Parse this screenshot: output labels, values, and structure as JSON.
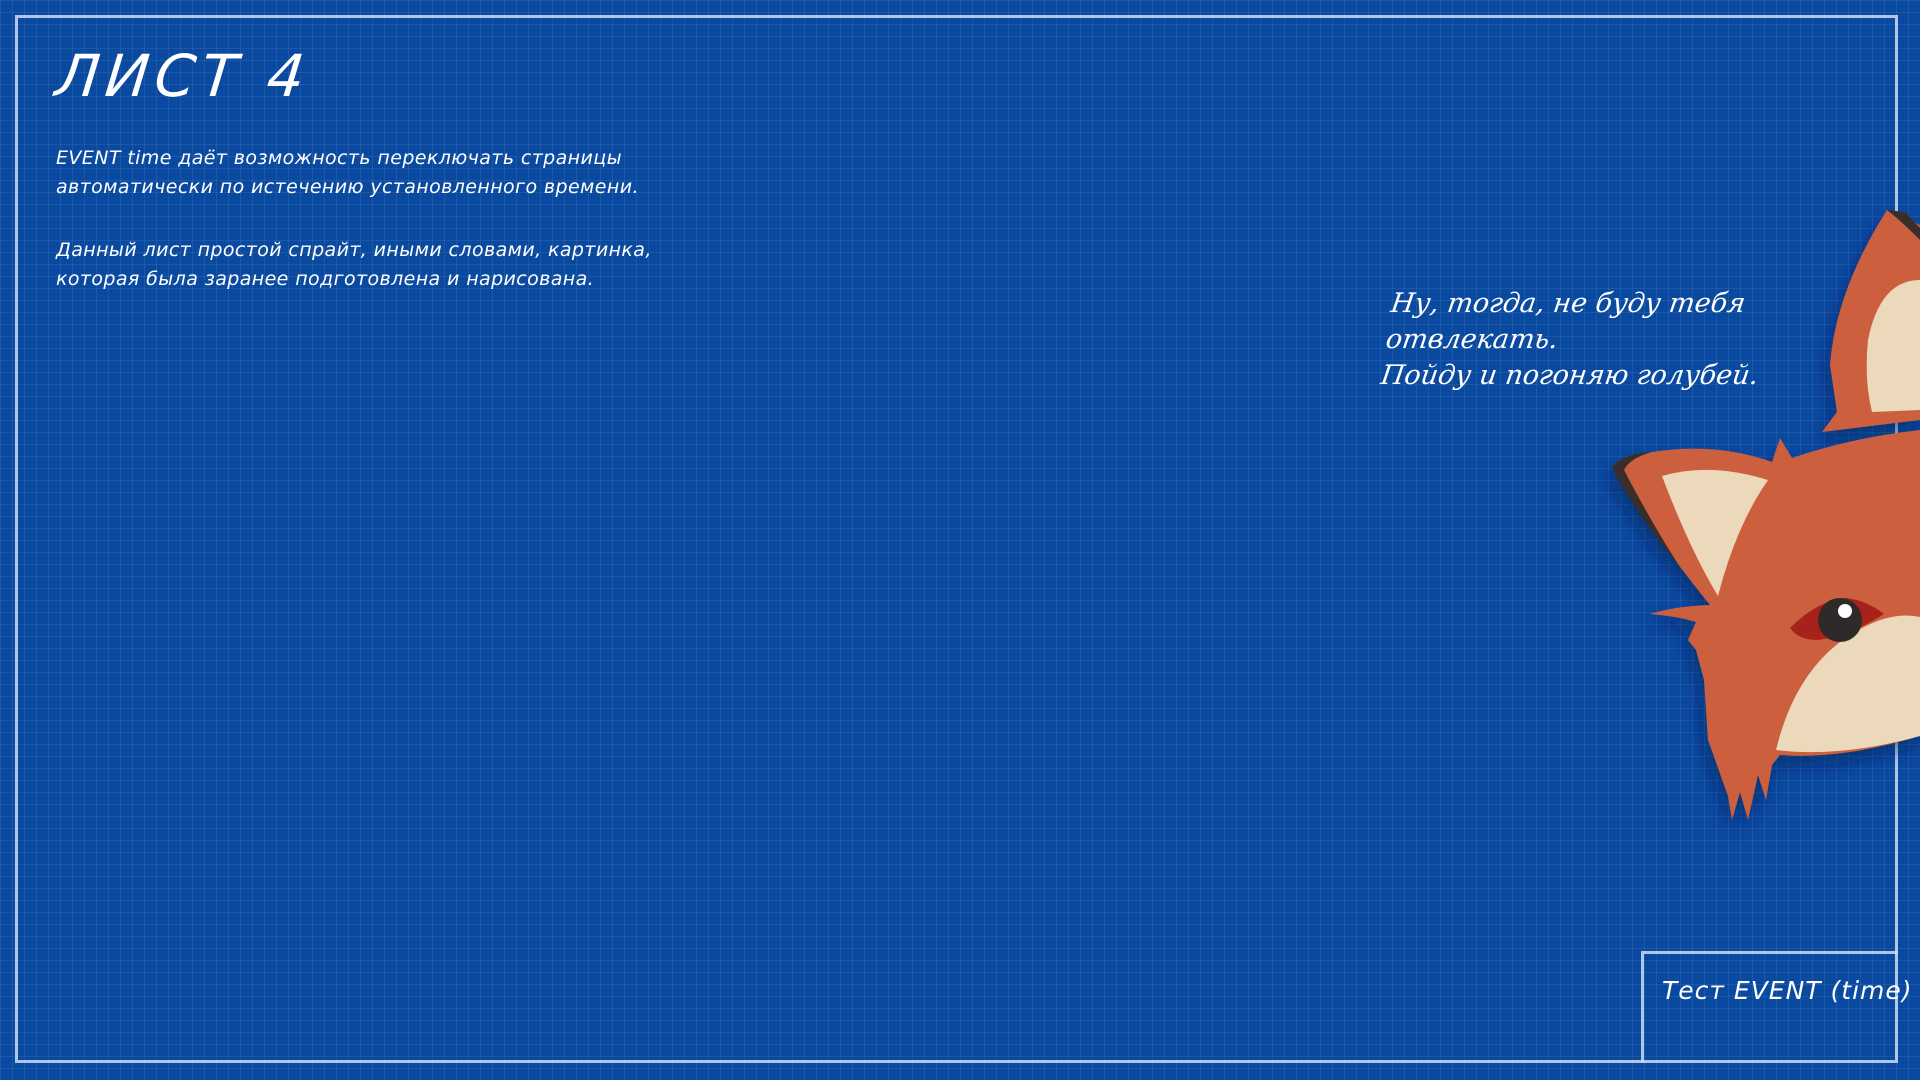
{
  "sheet": {
    "title": "ЛИСТ 4",
    "description_1": [
      "EVENT time даёт возможность переключать страницы",
      "автоматически по истечению установленного времени."
    ],
    "description_2": [
      "Данный лист простой спрайт, иными словами, картинка,",
      "которая была заранее подготовлена и нарисована."
    ]
  },
  "speech": {
    "lines": [
      "Ну, тогда, не буду тебя отвлекать.",
      "Пойду и погоняю голубей."
    ]
  },
  "stamp": {
    "label": "Тест EVENT (time)"
  },
  "colors": {
    "background": "#0a49a0",
    "frame": "#cddcf5",
    "fox_fur": "#cc5e3e",
    "fox_light": "#ecd8bb",
    "fox_outline": "#3a2e2a",
    "eye_lid": "#a8211f"
  },
  "icons": {
    "mascot": "fox-mascot-icon"
  }
}
